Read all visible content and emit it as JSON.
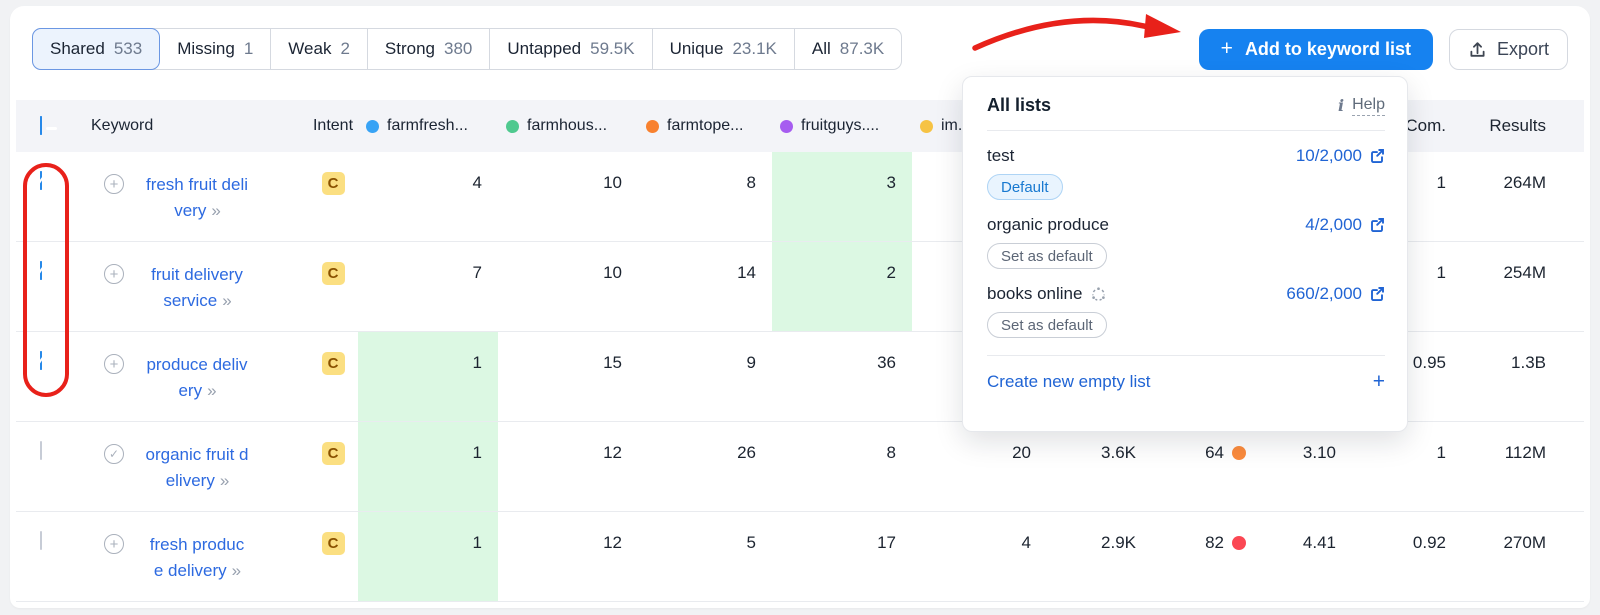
{
  "toolbar": {
    "tabs": [
      {
        "label": "Shared",
        "count": "533",
        "selected": true
      },
      {
        "label": "Missing",
        "count": "1"
      },
      {
        "label": "Weak",
        "count": "2"
      },
      {
        "label": "Strong",
        "count": "380"
      },
      {
        "label": "Untapped",
        "count": "59.5K"
      },
      {
        "label": "Unique",
        "count": "23.1K"
      },
      {
        "label": "All",
        "count": "87.3K"
      }
    ],
    "add_button_label": "Add to keyword list",
    "export_button_label": "Export"
  },
  "icons": {
    "plus": "+",
    "check": "✓",
    "info": "i",
    "keyword_chevrons": "»"
  },
  "table": {
    "header": {
      "keyword": "Keyword",
      "intent": "Intent",
      "competitors": [
        {
          "label": "farmfresh...",
          "color": "#38a3f5"
        },
        {
          "label": "farmhous...",
          "color": "#4fc98f"
        },
        {
          "label": "farmtope...",
          "color": "#f8812f"
        },
        {
          "label": "fruitguys....",
          "color": "#a65cf0"
        },
        {
          "label": "im...",
          "color": "#f6c344"
        }
      ],
      "com": "Com.",
      "results": "Results",
      "select_all_state": "indeterminate"
    },
    "rows": [
      {
        "keyword": "fresh fruit deli\nvery",
        "checked": true,
        "intent": "C",
        "c1": "4",
        "c2": "10",
        "c3": "8",
        "c4": "3",
        "c4_green": true,
        "com": "1",
        "results": "264M"
      },
      {
        "keyword": "fruit delivery\nservice",
        "checked": true,
        "intent": "C",
        "c1": "7",
        "c2": "10",
        "c3": "14",
        "c4": "2",
        "c4_green": true,
        "com": "1",
        "results": "254M"
      },
      {
        "keyword": "produce deliv\nery",
        "checked": true,
        "intent": "C",
        "c1": "1",
        "c1_green": true,
        "c2": "15",
        "c3": "9",
        "c4": "36",
        "com": "0.95",
        "results": "1.3B"
      },
      {
        "keyword": "organic fruit d\nelivery",
        "checked": false,
        "intent": "C",
        "c1": "1",
        "c1_green": true,
        "c2": "12",
        "c3": "26",
        "c4": "8",
        "c5": "20",
        "volume": "3.6K",
        "kd": "64",
        "kd_color": "#fb8b3d",
        "cpc": "3.10",
        "com": "1",
        "results": "112M"
      },
      {
        "keyword": "fresh produc\ne delivery",
        "checked": false,
        "intent": "C",
        "c1": "1",
        "c1_green": true,
        "c2": "12",
        "c3": "5",
        "c4": "17",
        "c5": "4",
        "volume": "2.9K",
        "kd": "82",
        "kd_color": "#fb4753",
        "cpc": "4.41",
        "com": "0.92",
        "results": "270M"
      }
    ]
  },
  "dropdown": {
    "title": "All lists",
    "help_label": "Help",
    "lists": [
      {
        "name": "test",
        "usage": "10/2,000",
        "badge": "Default"
      },
      {
        "name": "organic produce",
        "usage": "4/2,000",
        "badge": "Set as default"
      },
      {
        "name": "books online",
        "usage": "660/2,000",
        "badge": "Set as default"
      }
    ],
    "create_label": "Create new empty list",
    "create_plus": "+"
  },
  "colors": {
    "annotation_red": "#e8211a",
    "primary_blue": "#1682f0",
    "link_blue": "#2064d4",
    "green_highlight": "#dcf8e3"
  }
}
